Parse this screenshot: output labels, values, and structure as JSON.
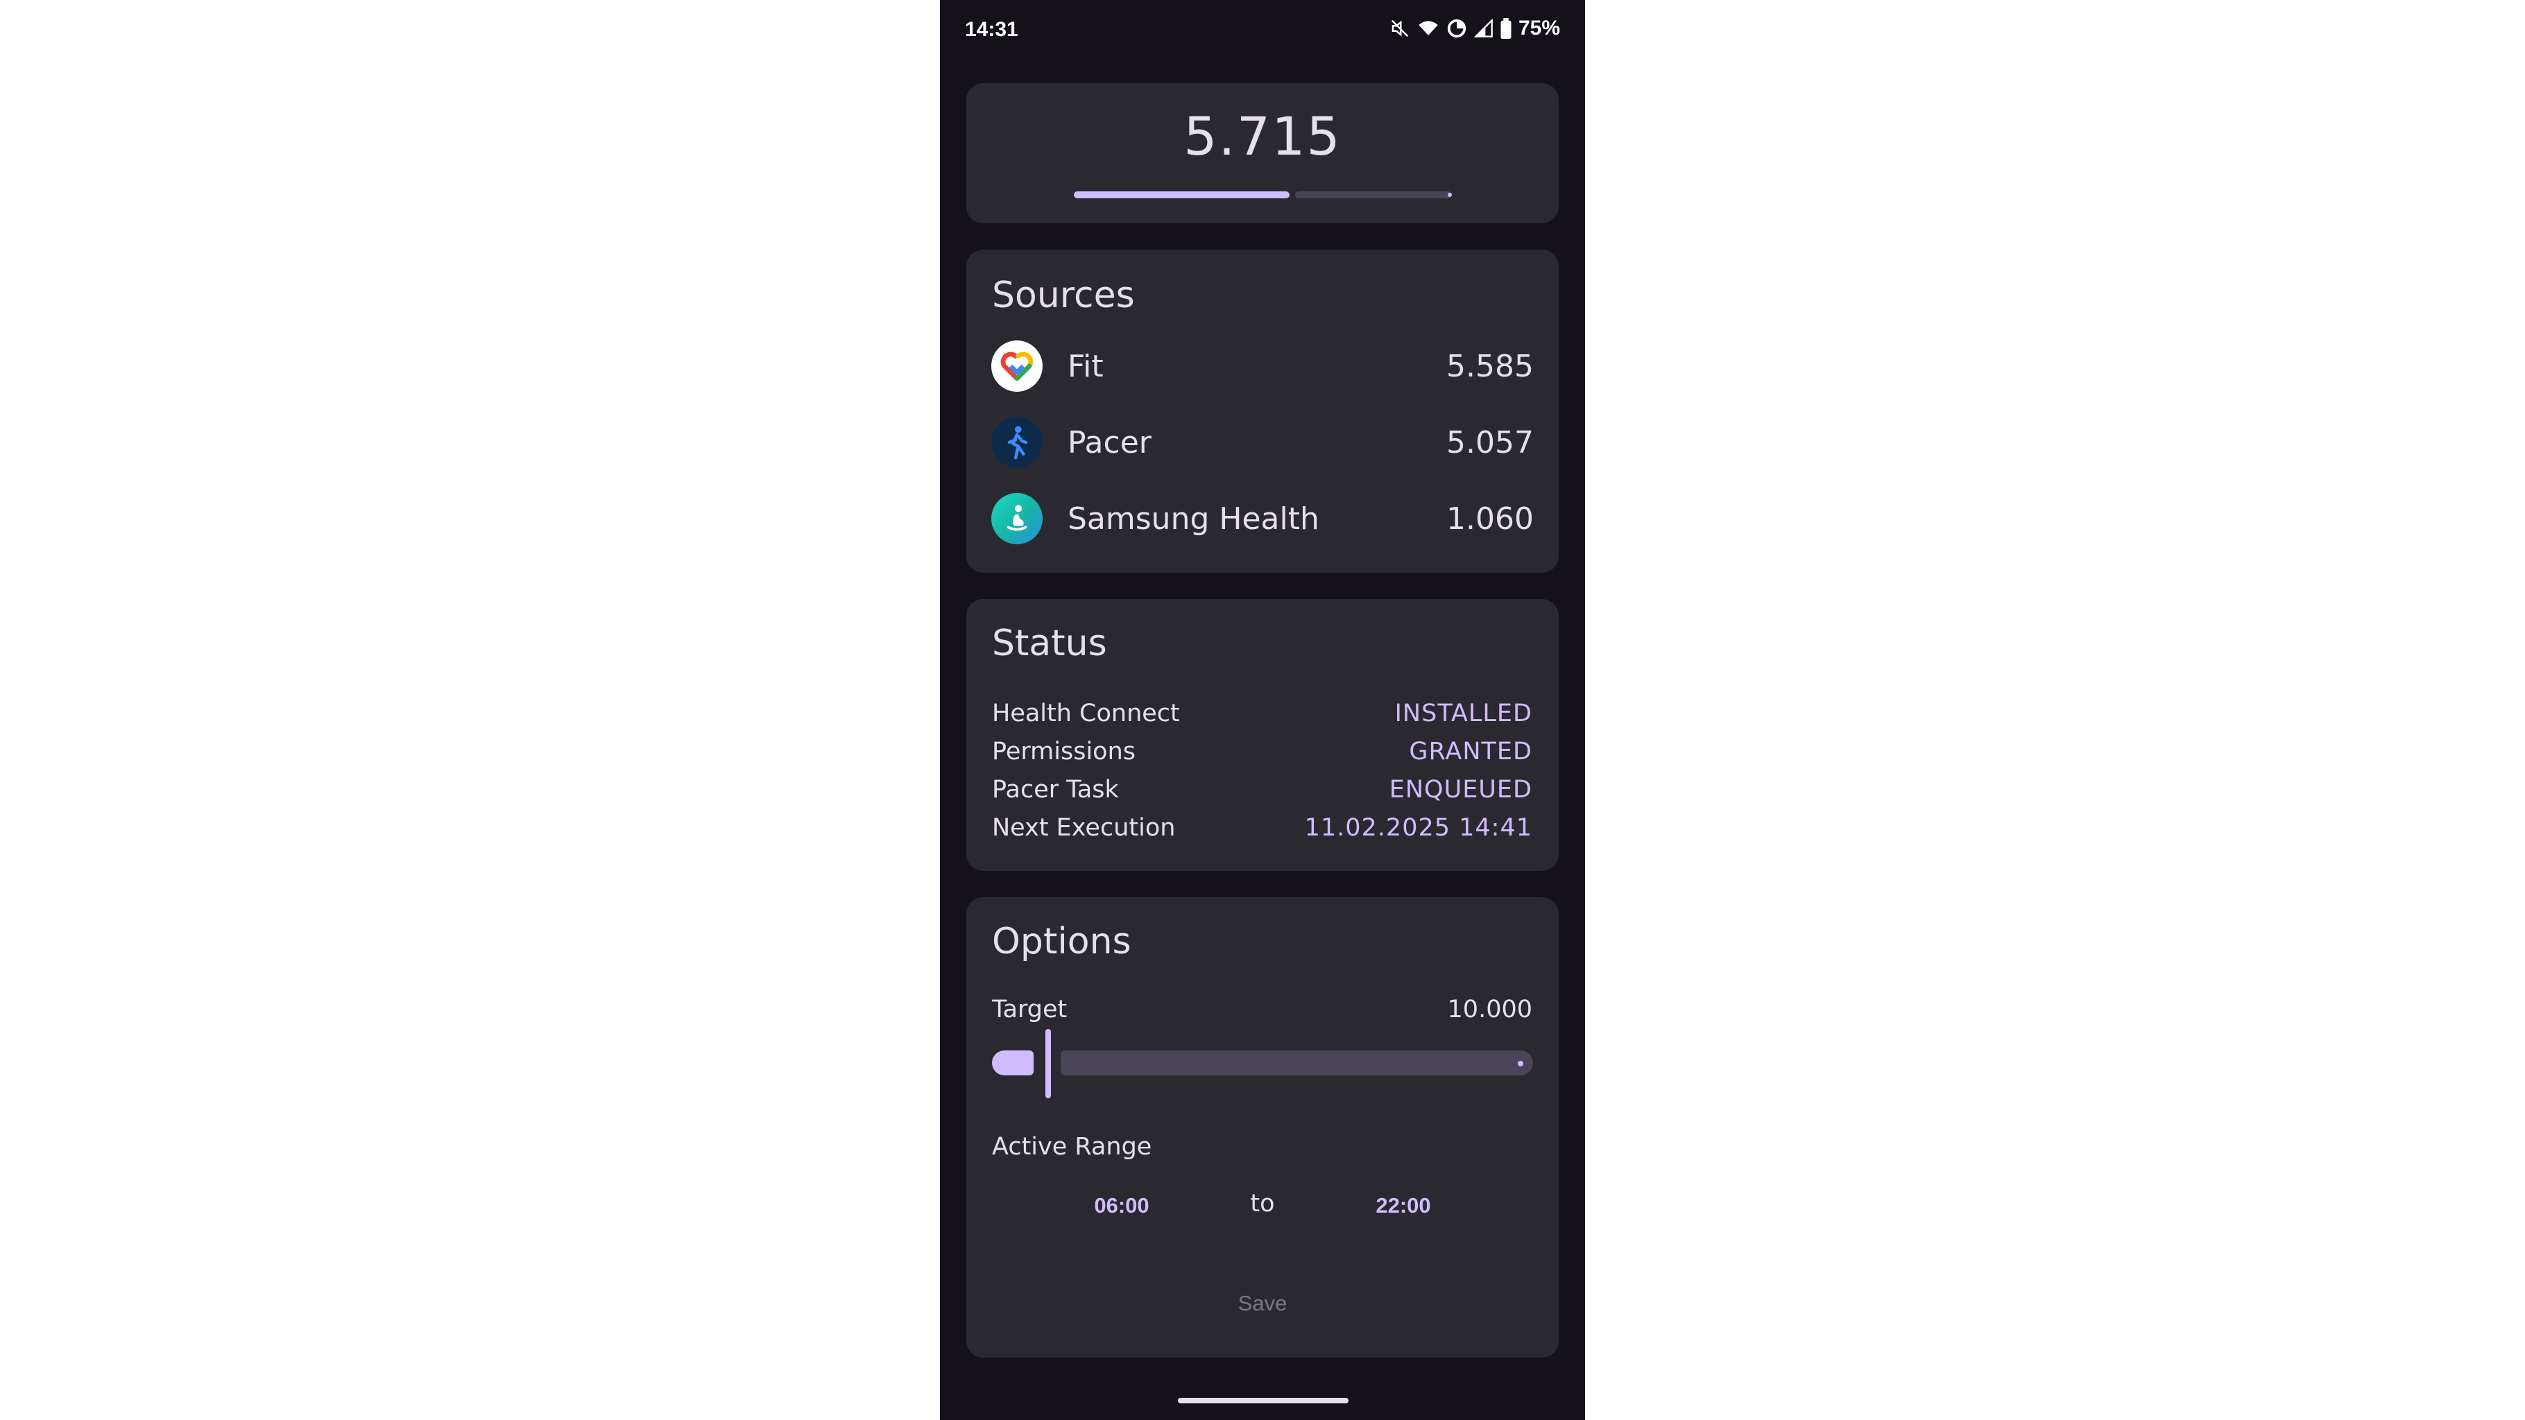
{
  "status_bar": {
    "time": "14:31",
    "battery": "75%",
    "icons": [
      "mute-icon",
      "wifi-icon",
      "data-saver-icon",
      "signal-icon",
      "battery-icon"
    ]
  },
  "steps": {
    "value": "5.715",
    "progress_fraction": 0.5715
  },
  "sources": {
    "title": "Sources",
    "items": [
      {
        "name": "Fit",
        "value": "5.585",
        "icon": "google-fit-icon"
      },
      {
        "name": "Pacer",
        "value": "5.057",
        "icon": "pacer-icon"
      },
      {
        "name": "Samsung Health",
        "value": "1.060",
        "icon": "samsung-health-icon"
      }
    ]
  },
  "status": {
    "title": "Status",
    "rows": [
      {
        "label": "Health Connect",
        "value": "INSTALLED"
      },
      {
        "label": "Permissions",
        "value": "GRANTED"
      },
      {
        "label": "Pacer Task",
        "value": "ENQUEUED"
      },
      {
        "label": "Next Execution",
        "value": "11.02.2025 14:41"
      }
    ]
  },
  "options": {
    "title": "Options",
    "target_label": "Target",
    "target_value": "10.000",
    "active_range_label": "Active Range",
    "from_time": "06:00",
    "to_label": "to",
    "to_time": "22:00",
    "save_label": "Save"
  },
  "colors": {
    "background": "#141218",
    "card": "#2b2930",
    "accent": "#d0bcff",
    "track": "#4a4458",
    "text": "#e6e0e9"
  }
}
